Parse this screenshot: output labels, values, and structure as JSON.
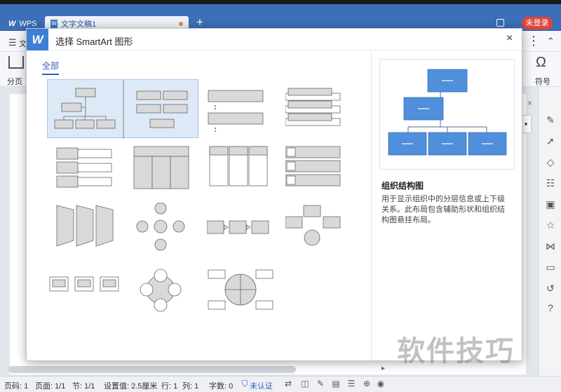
{
  "window": {
    "tabs": [
      {
        "label": "WPS",
        "icon": "wps-logo-icon"
      },
      {
        "label": "文字文稿1",
        "icon": "document-icon",
        "modified": true
      }
    ],
    "new_tab_symbol": "+",
    "login_label": "未登录"
  },
  "menubar": {
    "visible_item": "文"
  },
  "ribbon": {
    "page_break_label": "分页",
    "symbol_label": "符号"
  },
  "dialog": {
    "title": "选择 SmartArt 图形",
    "close_symbol": "×",
    "categories": [
      "全部"
    ],
    "selected_category": "全部",
    "layouts": [
      {
        "id": "org-chart",
        "selected": true
      },
      {
        "id": "hierarchy-blocks"
      },
      {
        "id": "list-bars"
      },
      {
        "id": "stacked-bars"
      },
      {
        "id": "vertical-bullet-list"
      },
      {
        "id": "table-hierarchy"
      },
      {
        "id": "column-list"
      },
      {
        "id": "picture-list"
      },
      {
        "id": "chevron-process"
      },
      {
        "id": "radial-arrows"
      },
      {
        "id": "basic-process"
      },
      {
        "id": "converging-arrows"
      },
      {
        "id": "bending-process"
      },
      {
        "id": "radial-cycle"
      },
      {
        "id": "segmented-cycle"
      }
    ],
    "preview": {
      "name": "组织结构图",
      "description": "用于显示组织中的分层信息或上下级关系。此布局包含辅助形状和组织结构图悬挂布局。",
      "shape_color": "#4f8fdc"
    }
  },
  "statusbar": {
    "page_code": "页码: 1",
    "pages": "页面: 1/1",
    "section": "节: 1/1",
    "setting": "设置值: 2.5厘米",
    "row": "行: 1",
    "column": "列: 1",
    "word_count": "字数: 0",
    "certification": "未认证"
  },
  "watermark": "软件技巧"
}
